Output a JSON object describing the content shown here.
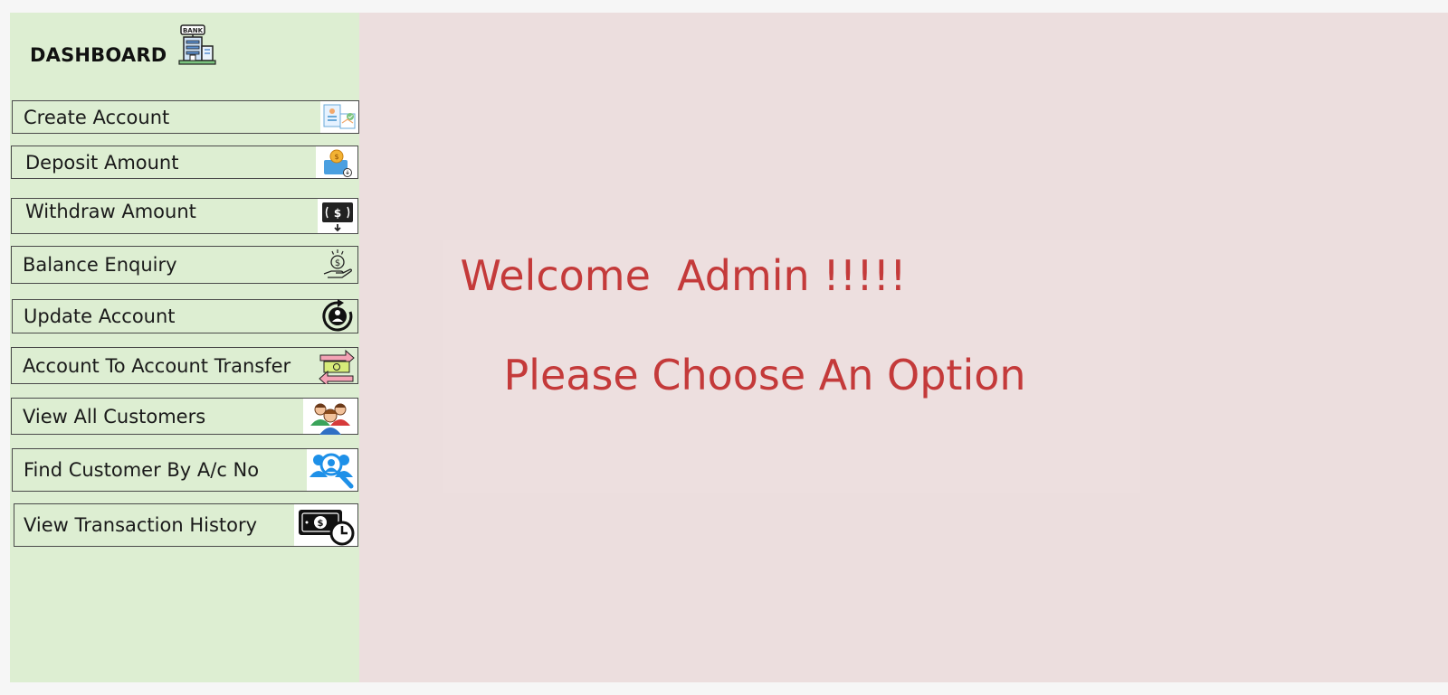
{
  "sidebar": {
    "title": "DASHBOARD",
    "bank_icon_text": "BANK",
    "items": [
      {
        "label": "Create Account",
        "icon": "create-account-icon"
      },
      {
        "label": "Deposit Amount",
        "icon": "deposit-icon"
      },
      {
        "label": "Withdraw Amount",
        "icon": "withdraw-icon"
      },
      {
        "label": "Balance Enquiry",
        "icon": "balance-enquiry-icon"
      },
      {
        "label": "Update Account",
        "icon": "update-account-icon"
      },
      {
        "label": "Account To Account Transfer",
        "icon": "transfer-icon"
      },
      {
        "label": "View All Customers",
        "icon": "customers-icon"
      },
      {
        "label": "Find Customer By A/c No",
        "icon": "find-customer-icon"
      },
      {
        "label": "View Transaction History",
        "icon": "transaction-history-icon"
      }
    ]
  },
  "main": {
    "welcome_line": "Welcome  Admin !!!!!",
    "prompt_line": "Please Choose An Option"
  },
  "colors": {
    "sidebar_bg": "#ddeed2",
    "main_bg": "#ecdede",
    "welcome_text": "#c43a3a"
  }
}
